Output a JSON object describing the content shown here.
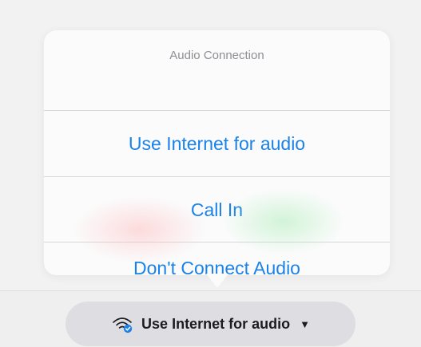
{
  "popover": {
    "title": "Audio Connection",
    "options": [
      "Use Internet for audio",
      "Call In",
      "Don't Connect Audio"
    ]
  },
  "audio_button": {
    "label": "Use Internet for audio",
    "icon": "wifi-audio-icon",
    "dropdown_icon": "caret-down-icon"
  },
  "colors": {
    "accent": "#1a82e8",
    "title_gray": "#8e8e93",
    "check_badge": "#1a82e8"
  }
}
